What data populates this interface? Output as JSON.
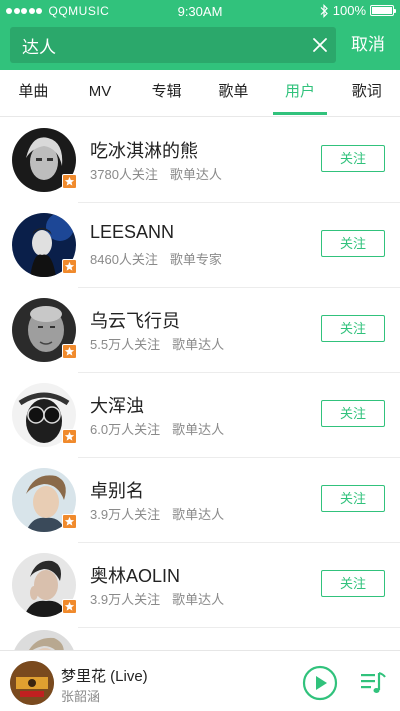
{
  "status_bar": {
    "carrier": "QQMUSIC",
    "time": "9:30AM",
    "battery": "100%"
  },
  "search": {
    "value": "达人",
    "cancel_label": "取消"
  },
  "tabs": [
    {
      "label": "单曲",
      "active": false
    },
    {
      "label": "MV",
      "active": false
    },
    {
      "label": "专辑",
      "active": false
    },
    {
      "label": "歌单",
      "active": false
    },
    {
      "label": "用户",
      "active": true
    },
    {
      "label": "歌词",
      "active": false
    }
  ],
  "users": [
    {
      "name": "吃冰淇淋的熊",
      "followers": "3780人关注",
      "role": "歌单达人",
      "button": "关注"
    },
    {
      "name": "LEESANN",
      "followers": "8460人关注",
      "role": "歌单专家",
      "button": "关注"
    },
    {
      "name": "乌云飞行员",
      "followers": "5.5万人关注",
      "role": "歌单达人",
      "button": "关注"
    },
    {
      "name": "大浑浊",
      "followers": "6.0万人关注",
      "role": "歌单达人",
      "button": "关注"
    },
    {
      "name": "卓别名",
      "followers": "3.9万人关注",
      "role": "歌单达人",
      "button": "关注"
    },
    {
      "name": "奥林AOLIN",
      "followers": "3.9万人关注",
      "role": "歌单达人",
      "button": "关注"
    }
  ],
  "player": {
    "title": "梦里花 (Live)",
    "artist": "张韶涵"
  },
  "colors": {
    "brand_green": "#31c27c",
    "search_bg": "#2ba86b",
    "badge_orange": "#f08a2c"
  },
  "icons": {
    "search_clear": "close-icon",
    "badge": "star-icon",
    "play": "play-icon",
    "playlist": "playlist-icon"
  }
}
